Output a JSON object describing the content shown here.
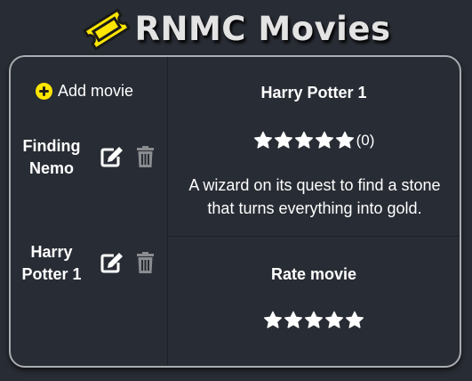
{
  "app": {
    "title": "RNMC Movies",
    "logo_icon": "ticket-icon"
  },
  "sidebar": {
    "add_label": "Add movie",
    "add_icon": "plus-circle-icon",
    "movies": [
      {
        "title_line1": "Finding",
        "title_line2": "Nemo",
        "edit_icon": "edit-icon",
        "delete_icon": "trash-icon"
      },
      {
        "title_line1": "Harry",
        "title_line2": "Potter 1",
        "edit_icon": "edit-icon",
        "delete_icon": "trash-icon"
      }
    ]
  },
  "details": {
    "title": "Harry Potter 1",
    "rating_stars": 5,
    "rating_count": "(0)",
    "description": "A wizard on its quest to find a stone that turns everything into gold."
  },
  "rate": {
    "title": "Rate movie",
    "stars": 5
  },
  "colors": {
    "background": "#282c34",
    "accent": "#ffe600",
    "border": "#a9acb1",
    "muted_icon": "#8a8c90"
  }
}
